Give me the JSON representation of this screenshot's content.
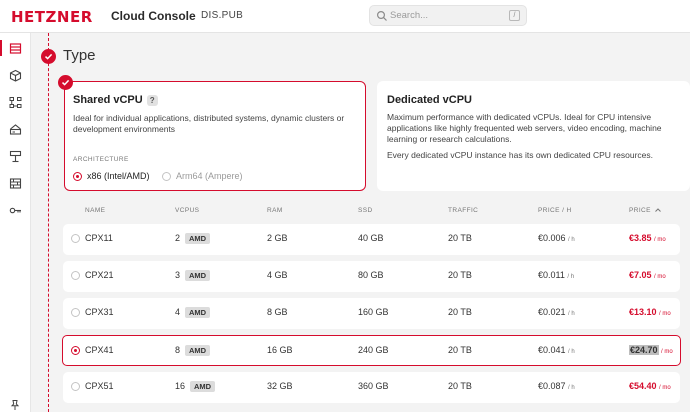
{
  "app": {
    "logo": "HETZNER",
    "product": "Cloud Console",
    "project": "DIS.PUB"
  },
  "search": {
    "placeholder": "Search...",
    "shortcut": "/",
    "icon": "search-icon"
  },
  "sidebar": {
    "items": [
      {
        "icon": "servers-icon",
        "active": true
      },
      {
        "icon": "cube-icon",
        "active": false
      },
      {
        "icon": "network-icon",
        "active": false
      },
      {
        "icon": "storage-icon",
        "active": false
      },
      {
        "icon": "load-balancer-icon",
        "active": false
      },
      {
        "icon": "firewall-icon",
        "active": false
      },
      {
        "icon": "key-icon",
        "active": false
      }
    ],
    "bottom_icon": "pin-icon"
  },
  "step": {
    "title": "Type"
  },
  "types": [
    {
      "title": "Shared vCPU",
      "help": "?",
      "description": "Ideal for individual applications, distributed systems, dynamic clusters or development environments",
      "selected": true,
      "architecture_label": "ARCHITECTURE",
      "architectures": [
        {
          "label": "x86 (Intel/AMD)",
          "selected": true
        },
        {
          "label": "Arm64 (Ampere)",
          "selected": false
        }
      ]
    },
    {
      "title": "Dedicated vCPU",
      "description": "Maximum performance with dedicated vCPUs. Ideal for CPU intensive applications like highly frequented web servers, video encoding, machine learning or research calculations.",
      "note": "Every dedicated vCPU instance has its own dedicated CPU resources.",
      "selected": false
    }
  ],
  "table": {
    "columns": [
      "NAME",
      "VCPUS",
      "RAM",
      "SSD",
      "TRAFFIC",
      "PRICE / H",
      "PRICE"
    ],
    "unit_hour": "/ h",
    "unit_month": "/ mo",
    "rows": [
      {
        "name": "CPX11",
        "vcpus": "2",
        "cpu": "AMD",
        "ram": "2 GB",
        "ssd": "40 GB",
        "traffic": "20 TB",
        "price_h": "€0.006",
        "price": "€3.85",
        "selected": false
      },
      {
        "name": "CPX21",
        "vcpus": "3",
        "cpu": "AMD",
        "ram": "4 GB",
        "ssd": "80 GB",
        "traffic": "20 TB",
        "price_h": "€0.011",
        "price": "€7.05",
        "selected": false
      },
      {
        "name": "CPX31",
        "vcpus": "4",
        "cpu": "AMD",
        "ram": "8 GB",
        "ssd": "160 GB",
        "traffic": "20 TB",
        "price_h": "€0.021",
        "price": "€13.10",
        "selected": false
      },
      {
        "name": "CPX41",
        "vcpus": "8",
        "cpu": "AMD",
        "ram": "16 GB",
        "ssd": "240 GB",
        "traffic": "20 TB",
        "price_h": "€0.041",
        "price": "€24.70",
        "selected": true
      },
      {
        "name": "CPX51",
        "vcpus": "16",
        "cpu": "AMD",
        "ram": "32 GB",
        "ssd": "360 GB",
        "traffic": "20 TB",
        "price_h": "€0.087",
        "price": "€54.40",
        "selected": false
      }
    ]
  },
  "colors": {
    "accent": "#d50c2d",
    "background": "#f3f3f3",
    "card": "#ffffff"
  }
}
